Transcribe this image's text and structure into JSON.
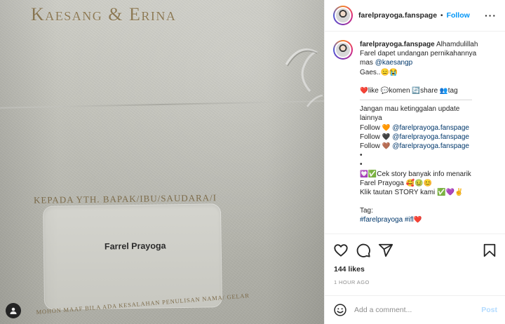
{
  "photo": {
    "card_title": "Kaesang & Erina",
    "addressee_label": "KEPADA YTH. BAPAK/IBU/SAUDARA/I",
    "recipient_name": "Farrel Prayoga",
    "disclaimer": "MOHON MAAF BILA ADA KESALAHAN PENULISAN NAMA/ GELAR",
    "tag_icon": "person-tag-icon"
  },
  "header": {
    "username": "farelprayoga.fanspage",
    "separator": "•",
    "follow_label": "Follow",
    "more_icon": "more-horizontal-icon"
  },
  "caption": {
    "username": "farelprayoga.fanspage",
    "line1": "Alhamdulillah",
    "line2": "Farel dapet undangan pernikahannya",
    "line3_prefix": "mas",
    "line3_mention": "@kaesangp",
    "line4": "Gaes..😑😭",
    "line5_like": "like",
    "line5_komen": "komen",
    "line5_share": "share",
    "line5_tag": "tag",
    "divider": "————————————————",
    "line7": "Jangan mau ketinggalan update",
    "line8": "lainnya",
    "follow_prefix": "Follow",
    "follow_handle": "@farelprayoga.fanspage",
    "bullet": "•",
    "line14": "✅Cek story banyak info menarik",
    "line15": "Farel Prayoga 🥰🤢😊",
    "line16": "Klik tautan STORY kami ✅💜✌",
    "tag_label": "Tag:",
    "hashtags": "#farelprayoga #ifl"
  },
  "actions": {
    "icons": [
      "heart-icon",
      "comment-icon",
      "share-icon",
      "bookmark-icon"
    ]
  },
  "likes": "144 likes",
  "time": "1 HOUR AGO",
  "comment": {
    "placeholder": "Add a comment...",
    "post_label": "Post"
  },
  "colors": {
    "accent": "#0095f6",
    "link": "#00376b",
    "gold_text": "#8d7a55",
    "muted": "#8e8e8e"
  }
}
